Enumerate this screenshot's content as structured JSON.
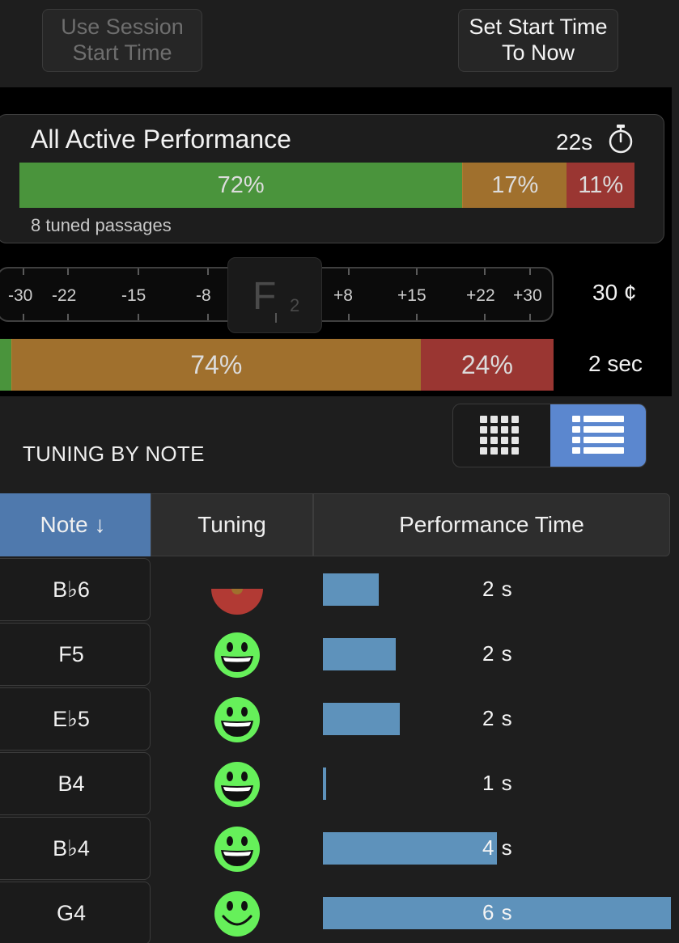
{
  "top_buttons": {
    "use_session_line1": "Use Session",
    "use_session_line2": "Start Time",
    "set_now_line1": "Set Start Time",
    "set_now_line2": "To Now"
  },
  "performance": {
    "title": "All Active Performance",
    "elapsed": "22s",
    "green_pct": "72%",
    "orange_pct": "17%",
    "red_pct": "11%",
    "green_value": 72,
    "orange_value": 17,
    "red_value": 11,
    "subtitle": "8 tuned passages"
  },
  "meter": {
    "ticks": [
      "-30",
      "-22",
      "-15",
      "-8",
      "+8",
      "+15",
      "+22",
      "+30"
    ],
    "note": "F",
    "octave": "2",
    "cents_label": "30 ¢"
  },
  "current_bar": {
    "green_value": 2,
    "orange_pct": "74%",
    "red_pct": "24%",
    "orange_value": 74,
    "red_value": 24,
    "duration": "2 sec"
  },
  "section_title": "TUNING BY NOTE",
  "view_toggle": {
    "grid_icon": "grid-icon",
    "list_icon": "list-icon",
    "active": "list"
  },
  "table": {
    "headers": {
      "note": "Note ↓",
      "tuning": "Tuning",
      "time": "Performance Time"
    },
    "rows": [
      {
        "note": "B♭6",
        "tuning": "red-partial-icon",
        "seconds": 2,
        "fraction": 0.16,
        "time": "2 s"
      },
      {
        "note": "F5",
        "tuning": "grin-face-icon",
        "seconds": 2,
        "fraction": 0.21,
        "time": "2 s"
      },
      {
        "note": "E♭5",
        "tuning": "grin-face-icon",
        "seconds": 2,
        "fraction": 0.22,
        "time": "2 s"
      },
      {
        "note": "B4",
        "tuning": "grin-face-icon",
        "seconds": 1,
        "fraction": 0.01,
        "time": "1 s"
      },
      {
        "note": "B♭4",
        "tuning": "grin-face-icon",
        "seconds": 4,
        "fraction": 0.5,
        "time": "4 s"
      },
      {
        "note": "G4",
        "tuning": "smile-face-icon",
        "seconds": 6,
        "fraction": 1.0,
        "time": "6 s"
      }
    ]
  },
  "colors": {
    "green": "#4a943c",
    "orange": "#a0702d",
    "red": "#9a3632",
    "accent_blue": "#5b87cf",
    "time_bar": "#5e92bb",
    "face_green": "#66f05a"
  }
}
